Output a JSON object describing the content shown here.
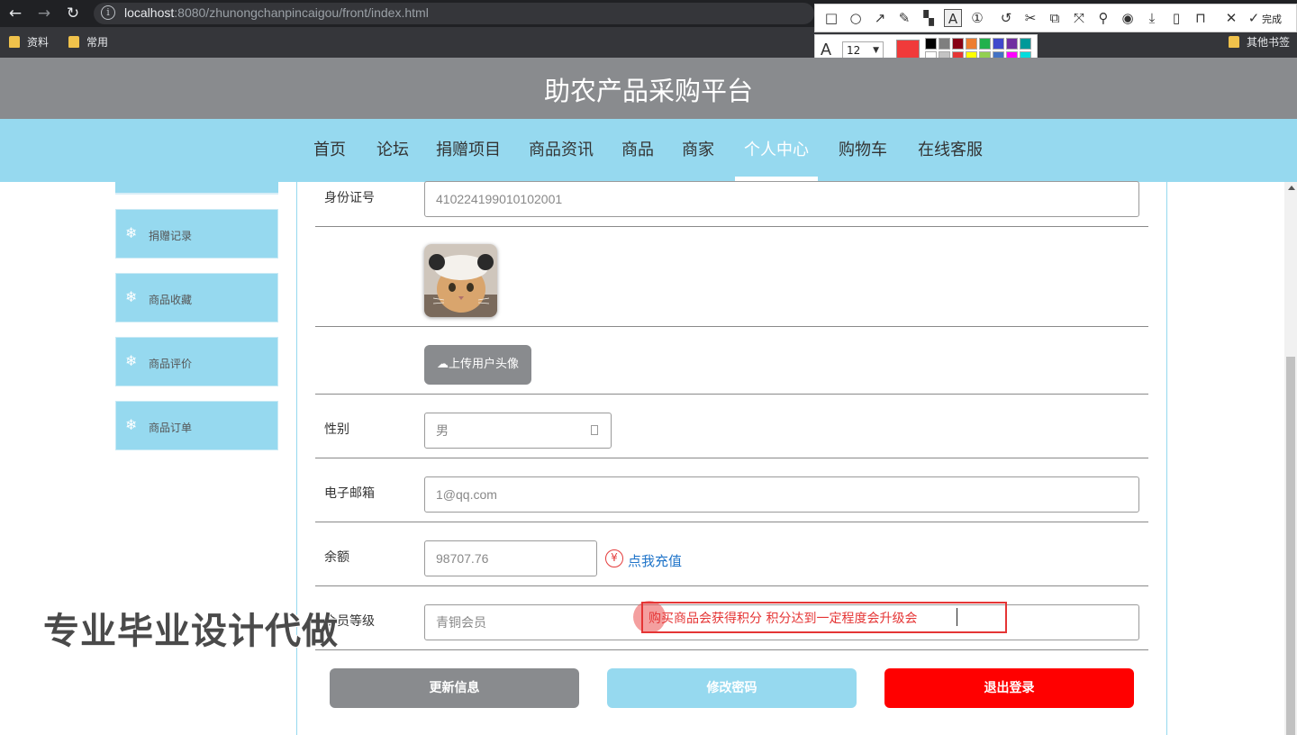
{
  "browser": {
    "url_host": "localhost",
    "url_rest": ":8080/zhunongchanpincaigou/front/index.html",
    "bookmarks": [
      "资料",
      "常用"
    ],
    "other_bookmarks": "其他书签"
  },
  "annotation_toolbar": {
    "tools": [
      "rectangle-icon",
      "ellipse-icon",
      "arrow-icon",
      "pencil-icon",
      "mosaic-icon",
      "text-icon",
      "number-icon",
      "undo-icon",
      "crop-icon",
      "translate-icon",
      "ocr-icon",
      "pin-icon",
      "record-icon",
      "download-icon",
      "mobile-icon",
      "bookmark-icon",
      "close-icon",
      "check-icon"
    ],
    "done_label": "完成",
    "font_size": "12",
    "current_color": "#f03a3a",
    "palette": [
      "#000000",
      "#7f7f7f",
      "#880015",
      "#ed7d31",
      "#22b14c",
      "#3f48cc",
      "#7030a0",
      "#009999",
      "#ffffff",
      "#c3c3c3",
      "#e53535",
      "#ffff00",
      "#92d050",
      "#4472c4",
      "#ff00ff",
      "#00dddd"
    ]
  },
  "site": {
    "title": "助农产品采购平台",
    "nav": [
      {
        "label": "首页"
      },
      {
        "label": "论坛"
      },
      {
        "label": "捐赠项目"
      },
      {
        "label": "商品资讯"
      },
      {
        "label": "商品"
      },
      {
        "label": "商家"
      },
      {
        "label": "个人中心",
        "active": true
      },
      {
        "label": "购物车"
      },
      {
        "label": "在线客服"
      }
    ]
  },
  "sidebar": {
    "items": [
      {
        "label": "捐赠记录"
      },
      {
        "label": "商品收藏"
      },
      {
        "label": "商品评价"
      },
      {
        "label": "商品订单"
      }
    ]
  },
  "form": {
    "id_label": "身份证号",
    "id_value": "410224199010102001",
    "upload_label": "上传用户头像",
    "gender_label": "性别",
    "gender_value": "男",
    "email_label": "电子邮箱",
    "email_value": "1@qq.com",
    "balance_label": "余额",
    "balance_value": "98707.76",
    "recharge_label": "点我充值",
    "level_label": "会员等级",
    "level_value": "青铜会员"
  },
  "actions": {
    "update": "更新信息",
    "change_password": "修改密码",
    "logout": "退出登录"
  },
  "overlay": {
    "annotation_text": "购买商品会获得积分 积分达到一定程度会升级会",
    "watermark": "专业毕业设计代做"
  }
}
